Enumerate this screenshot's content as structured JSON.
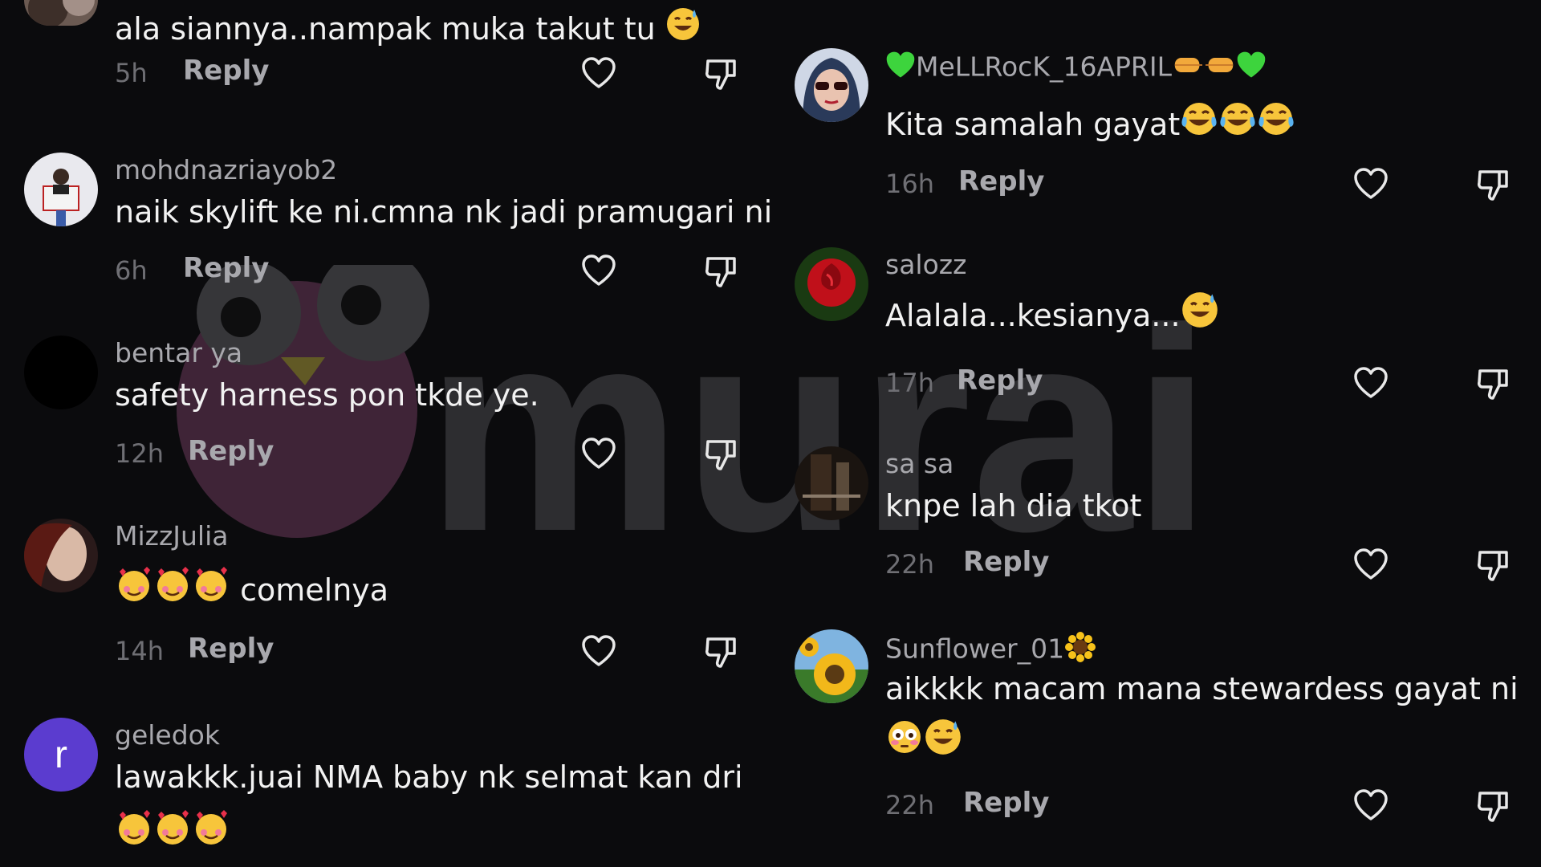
{
  "watermark": {
    "text": "murai"
  },
  "actions": {
    "reply_label": "Reply"
  },
  "left_column": [
    {
      "username": "",
      "text": "ala siannya..nampak muka takut tu",
      "text_emojis": [
        "sweat-smile"
      ],
      "time": "5h"
    },
    {
      "username": "mohdnazriayob2",
      "text": "naik skylift ke ni.cmna nk jadi pramugari ni",
      "text_emojis": [],
      "time": "6h"
    },
    {
      "username": "bentar ya",
      "text": "safety harness pon tkde ye.",
      "text_emojis": [],
      "time": "12h"
    },
    {
      "username": "MizzJulia",
      "text": "comelnya",
      "lead_emojis": [
        "smiling-hearts",
        "smiling-hearts",
        "smiling-hearts"
      ],
      "time": "14h"
    },
    {
      "username": "geledok",
      "avatar_letter": "r",
      "text": "lawakkk.juai NMA baby nk selmat kan dri",
      "line2_emojis": [
        "smiling-hearts",
        "smiling-hearts",
        "smiling-hearts"
      ],
      "time": ""
    }
  ],
  "right_column": [
    {
      "username": "MeLLRocK_16APRIL",
      "username_prefix_emojis": [
        "green-heart"
      ],
      "username_suffix_emojis": [
        "left-fist",
        "right-fist",
        "green-heart"
      ],
      "text": "Kita samalah gayat",
      "text_emojis": [
        "tears-of-joy",
        "tears-of-joy",
        "tears-of-joy"
      ],
      "time": "16h"
    },
    {
      "username": "salozz",
      "text": "Alalala...kesianya...",
      "text_emojis": [
        "sweat-smile"
      ],
      "time": "17h"
    },
    {
      "username": "sa sa",
      "text": "knpe lah dia tkot",
      "text_emojis": [],
      "time": "22h"
    },
    {
      "username": "Sunflower_01",
      "username_suffix_emojis": [
        "sunflower"
      ],
      "text": "aikkkk macam mana stewardess gayat ni",
      "line2_emojis": [
        "flushed",
        "sweat-smile"
      ],
      "time": "22h"
    }
  ],
  "colors": {
    "background": "#0b0b0d",
    "username": "#a8a8ad",
    "time": "#6f6f74",
    "text": "#f2f2f2",
    "avatar_purple": "#5b3ccf"
  }
}
